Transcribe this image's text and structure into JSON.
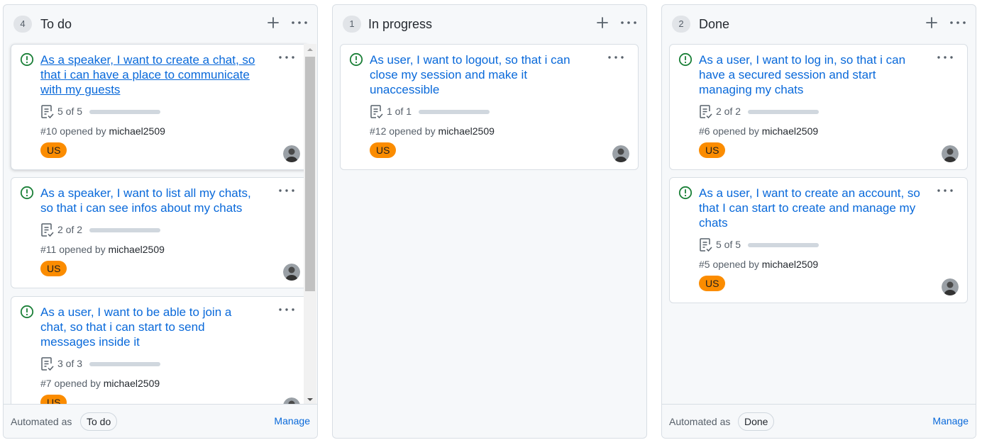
{
  "columns": [
    {
      "count": "4",
      "name": "To do",
      "automated_label": "Automated as",
      "automated_value": "To do",
      "manage_label": "Manage",
      "cards": [
        {
          "title": "As a speaker, I want to create a chat, so that i can have a place to communicate with my guests",
          "tasks": "5 of 5",
          "opened_prefix": "#10 opened by ",
          "author": "michael2509",
          "label": "US"
        },
        {
          "title": "As a speaker, I want to list all my chats, so that i can see infos about my chats",
          "tasks": "2 of 2",
          "opened_prefix": "#11 opened by ",
          "author": "michael2509",
          "label": "US"
        },
        {
          "title": "As a user, I want to be able to join a chat, so that i can start to send messages inside it",
          "tasks": "3 of 3",
          "opened_prefix": "#7 opened by ",
          "author": "michael2509",
          "label": "US"
        }
      ]
    },
    {
      "count": "1",
      "name": "In progress",
      "cards": [
        {
          "title": "As user, I want to logout, so that i can close my session and make it unaccessible",
          "tasks": "1 of 1",
          "opened_prefix": "#12 opened by ",
          "author": "michael2509",
          "label": "US"
        }
      ]
    },
    {
      "count": "2",
      "name": "Done",
      "automated_label": "Automated as",
      "automated_value": "Done",
      "manage_label": "Manage",
      "cards": [
        {
          "title": "As a user, I want to log in, so that i can have a secured session and start managing my chats",
          "tasks": "2 of 2",
          "opened_prefix": "#6 opened by ",
          "author": "michael2509",
          "label": "US"
        },
        {
          "title": "As a user, I want to create an account, so that I can start to create and manage my chats",
          "tasks": "5 of 5",
          "opened_prefix": "#5 opened by ",
          "author": "michael2509",
          "label": "US"
        }
      ]
    }
  ],
  "colors": {
    "issue_open": "#1a7f37",
    "link": "#0969da",
    "label_bg": "#fb8c00"
  },
  "icons": {
    "add": "plus-icon",
    "more": "kebab-horizontal-icon",
    "issue": "issue-opened-icon",
    "tasks": "checklist-icon"
  }
}
